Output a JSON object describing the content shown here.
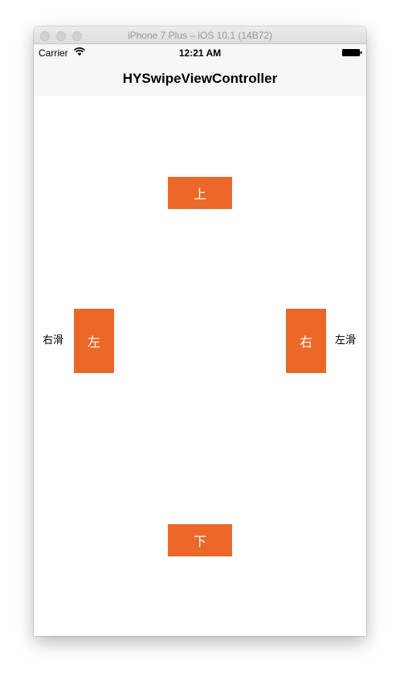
{
  "window": {
    "title": "iPhone 7 Plus – iOS 10.1 (14B72)"
  },
  "status_bar": {
    "carrier": "Carrier",
    "time": "12:21 AM",
    "icons": [
      "wifi-icon",
      "battery-icon"
    ]
  },
  "nav_bar": {
    "title": "HYSwipeViewController"
  },
  "buttons": {
    "up": "上",
    "down": "下",
    "left": "左",
    "right": "右",
    "color": "#ec6828",
    "text_color": "#ffffff"
  },
  "hints": {
    "left": "右滑",
    "right": "左滑"
  }
}
